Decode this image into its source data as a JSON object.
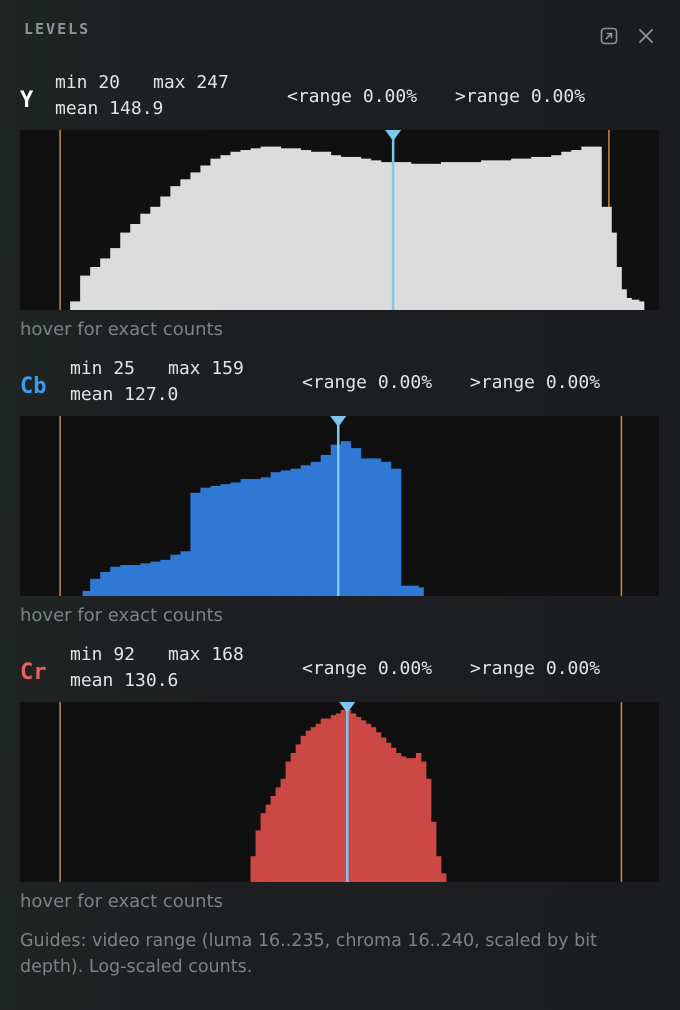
{
  "panel": {
    "title": "LEVELS",
    "icons": [
      "popout-icon",
      "close-icon"
    ],
    "hover_hint": "hover for exact counts",
    "note": "Guides: video range (luma 16..235, chroma 16..240, scaled by bit depth). Log-scaled counts.",
    "guide_color": "#c98a3b",
    "mean_marker_color": "#7cc6ef"
  },
  "channels": [
    {
      "id": "y",
      "label": "Y",
      "color": "#ffffff",
      "fill": "#dcdcdc",
      "min": "min 20",
      "max": "max 247",
      "mean": "mean 148.9",
      "under": "<range 0.00%",
      "over": ">range 0.00%"
    },
    {
      "id": "cb",
      "label": "Cb",
      "color": "#3a9af5",
      "fill": "#2f78d4",
      "min": "min 25",
      "max": "max 159",
      "mean": "mean 127.0",
      "under": "<range 0.00%",
      "over": ">range 0.00%"
    },
    {
      "id": "cr",
      "label": "Cr",
      "color": "#f06060",
      "fill": "#cc4845",
      "min": "min 92",
      "max": "max 168",
      "mean": "mean 130.6",
      "under": "<range 0.00%",
      "over": ">range 0.00%"
    }
  ],
  "chart_data": [
    {
      "type": "bar",
      "channel": "Y",
      "x_range": [
        0,
        255
      ],
      "guides": [
        16,
        235
      ],
      "mean": 148.9,
      "scale": "log",
      "x": [
        20,
        24,
        28,
        32,
        36,
        40,
        44,
        48,
        52,
        56,
        60,
        64,
        68,
        72,
        76,
        80,
        84,
        88,
        92,
        96,
        100,
        104,
        108,
        112,
        116,
        120,
        124,
        128,
        132,
        136,
        140,
        144,
        148,
        152,
        156,
        160,
        164,
        168,
        172,
        176,
        180,
        184,
        188,
        192,
        196,
        200,
        204,
        208,
        212,
        216,
        220,
        224,
        228,
        232,
        236,
        238,
        240,
        242,
        244,
        247
      ],
      "values": [
        0.05,
        0.2,
        0.25,
        0.3,
        0.36,
        0.45,
        0.5,
        0.56,
        0.6,
        0.66,
        0.72,
        0.76,
        0.8,
        0.84,
        0.88,
        0.9,
        0.92,
        0.93,
        0.94,
        0.95,
        0.95,
        0.94,
        0.94,
        0.93,
        0.92,
        0.92,
        0.9,
        0.89,
        0.89,
        0.88,
        0.87,
        0.86,
        0.86,
        0.86,
        0.85,
        0.85,
        0.85,
        0.86,
        0.86,
        0.86,
        0.86,
        0.87,
        0.87,
        0.87,
        0.88,
        0.88,
        0.89,
        0.89,
        0.9,
        0.92,
        0.93,
        0.95,
        0.95,
        0.6,
        0.45,
        0.25,
        0.12,
        0.07,
        0.06,
        0.05
      ]
    },
    {
      "type": "bar",
      "channel": "Cb",
      "x_range": [
        0,
        255
      ],
      "guides": [
        16,
        240
      ],
      "mean": 127.0,
      "scale": "log",
      "x": [
        25,
        28,
        32,
        36,
        40,
        44,
        48,
        52,
        56,
        60,
        64,
        68,
        72,
        76,
        80,
        84,
        88,
        92,
        96,
        100,
        104,
        108,
        112,
        116,
        120,
        124,
        128,
        132,
        136,
        140,
        144,
        148,
        152,
        156,
        159
      ],
      "values": [
        0.03,
        0.1,
        0.14,
        0.17,
        0.18,
        0.18,
        0.19,
        0.2,
        0.21,
        0.24,
        0.26,
        0.6,
        0.63,
        0.64,
        0.65,
        0.66,
        0.68,
        0.68,
        0.69,
        0.72,
        0.73,
        0.74,
        0.76,
        0.78,
        0.82,
        0.88,
        0.9,
        0.86,
        0.8,
        0.8,
        0.78,
        0.74,
        0.06,
        0.06,
        0.05
      ]
    },
    {
      "type": "bar",
      "channel": "Cr",
      "x_range": [
        0,
        255
      ],
      "guides": [
        16,
        240
      ],
      "mean": 130.6,
      "scale": "log",
      "x": [
        92,
        94,
        96,
        98,
        100,
        102,
        104,
        106,
        108,
        110,
        112,
        114,
        116,
        118,
        120,
        122,
        124,
        126,
        128,
        130,
        132,
        134,
        136,
        138,
        140,
        142,
        144,
        146,
        148,
        150,
        152,
        154,
        156,
        158,
        160,
        162,
        164,
        166,
        168
      ],
      "values": [
        0.15,
        0.3,
        0.4,
        0.45,
        0.5,
        0.55,
        0.6,
        0.7,
        0.75,
        0.8,
        0.85,
        0.88,
        0.9,
        0.92,
        0.95,
        0.95,
        0.97,
        0.98,
        1.0,
        1.0,
        0.98,
        0.96,
        0.94,
        0.92,
        0.9,
        0.87,
        0.84,
        0.81,
        0.78,
        0.75,
        0.73,
        0.72,
        0.72,
        0.75,
        0.7,
        0.6,
        0.35,
        0.15,
        0.05
      ]
    }
  ]
}
